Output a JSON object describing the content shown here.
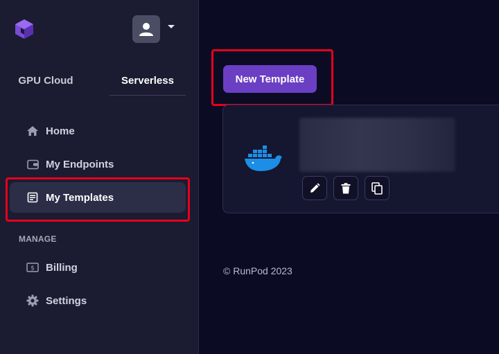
{
  "sidebar": {
    "tabs": [
      {
        "label": "GPU Cloud",
        "active": false
      },
      {
        "label": "Serverless",
        "active": true
      }
    ],
    "items": [
      {
        "label": "Home",
        "icon": "home-icon"
      },
      {
        "label": "My Endpoints",
        "icon": "wallet-icon"
      },
      {
        "label": "My Templates",
        "icon": "document-icon",
        "active": true
      }
    ],
    "section_label": "MANAGE",
    "manage_items": [
      {
        "label": "Billing",
        "icon": "dollar-icon"
      },
      {
        "label": "Settings",
        "icon": "gear-icon"
      }
    ]
  },
  "main": {
    "new_template_label": "New Template",
    "card": {
      "icon": "docker-icon",
      "actions": [
        "edit-icon",
        "delete-icon",
        "copy-icon"
      ]
    },
    "footer": "© RunPod 2023"
  },
  "colors": {
    "accent": "#6a3fc3",
    "highlight": "#e8001c",
    "background": "#0b0c24",
    "sidebar": "#1b1c31"
  }
}
